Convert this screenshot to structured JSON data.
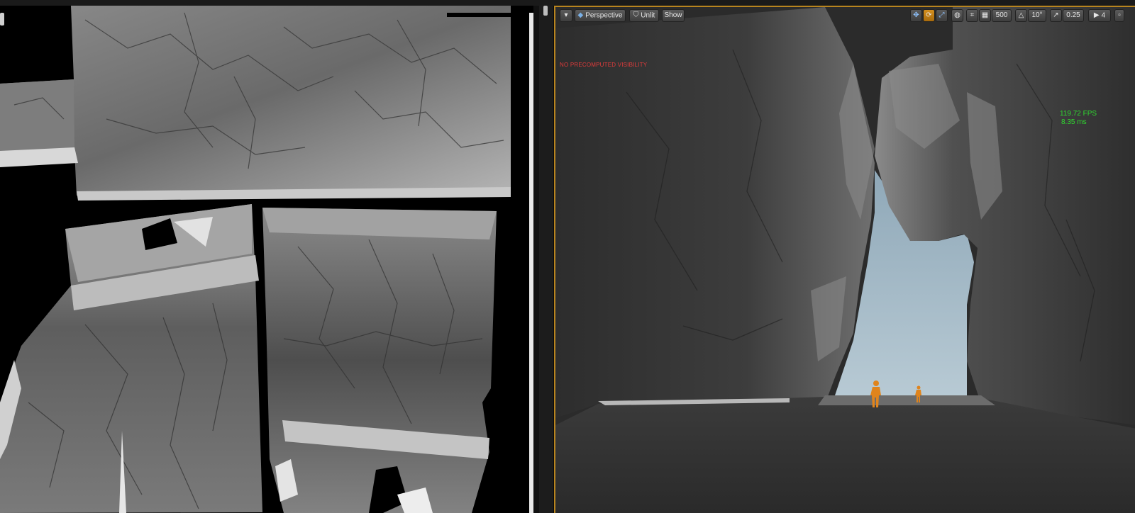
{
  "viewport": {
    "mode_dropdown_icon": "chevron-down-icon",
    "perspective_label": "Perspective",
    "lighting_label": "Unlit",
    "show_label": "Show",
    "grid_snap_value": "500",
    "rotation_snap_value": "10°",
    "scale_snap_value": "0.25",
    "camera_speed_value": "4",
    "precomputed_visibility_warning": "NO PRECOMPUTED VISIBILITY",
    "fps_text": "119.72 FPS",
    "frame_time_text": "8.35 ms",
    "accent_color": "#b8841e",
    "warning_color": "#e23b3b",
    "stats_color": "#2fdc2f"
  },
  "texture_panel": {
    "content": "baked-rock-texture-atlas"
  }
}
